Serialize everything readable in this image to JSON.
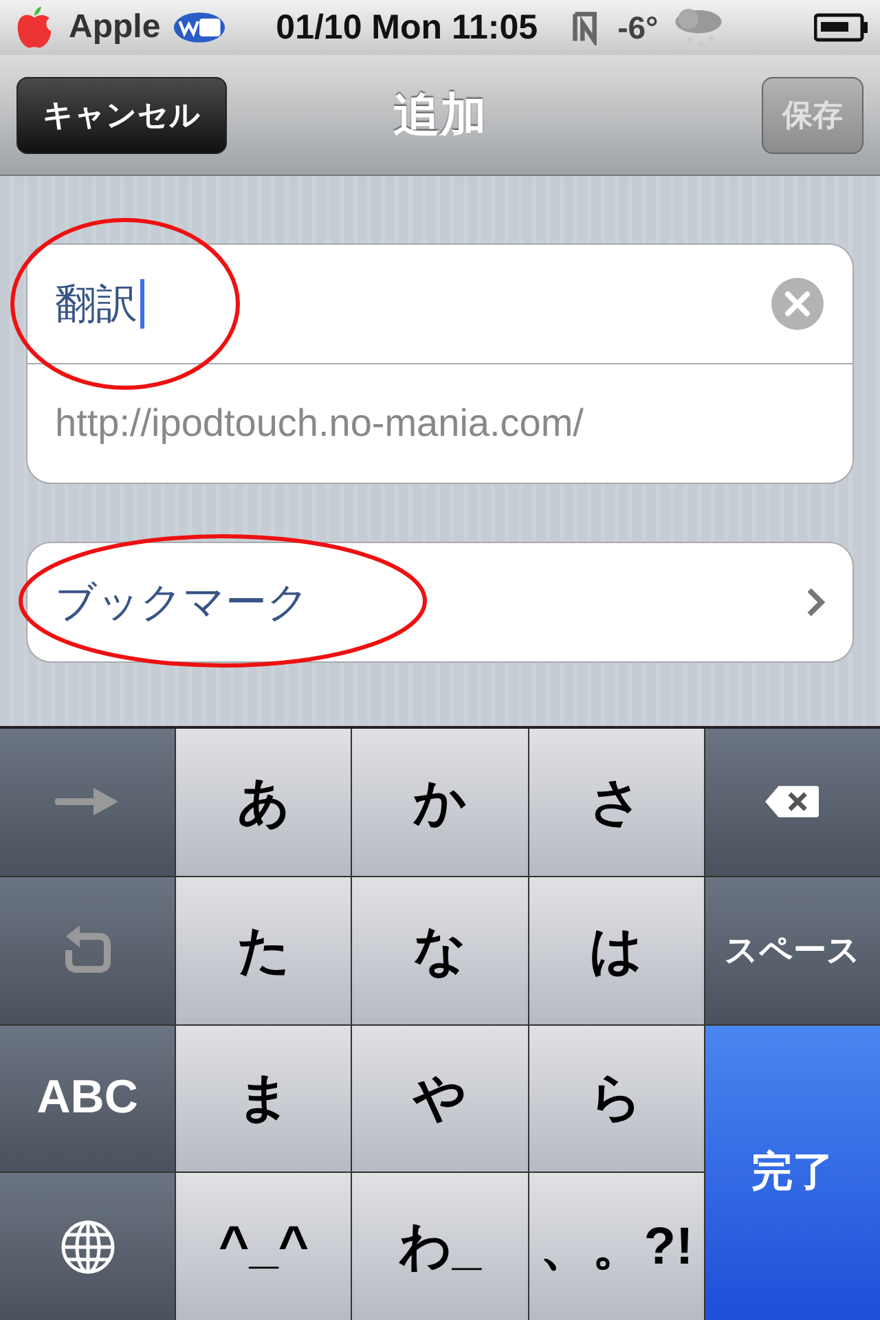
{
  "status_bar": {
    "carrier": "Apple",
    "datetime": "01/10 Mon 11:05",
    "temperature": "-6°"
  },
  "nav_bar": {
    "cancel": "キャンセル",
    "title": "追加",
    "save": "保存",
    "save_disabled": true
  },
  "form": {
    "title_value": "翻訳",
    "title_highlighted": true,
    "url": "http://ipodtouch.no-mania.com/",
    "folder": "ブックマーク",
    "folder_highlighted": true
  },
  "keyboard": {
    "keys": [
      {
        "kind": "arrow"
      },
      {
        "kind": "char",
        "label": "あ"
      },
      {
        "kind": "char",
        "label": "か"
      },
      {
        "kind": "char",
        "label": "さ"
      },
      {
        "kind": "backspace"
      },
      {
        "kind": "undo"
      },
      {
        "kind": "char",
        "label": "た"
      },
      {
        "kind": "char",
        "label": "な"
      },
      {
        "kind": "char",
        "label": "は"
      },
      {
        "kind": "function",
        "label": "スペース"
      },
      {
        "kind": "function",
        "label": "ABC"
      },
      {
        "kind": "char",
        "label": "ま"
      },
      {
        "kind": "char",
        "label": "や"
      },
      {
        "kind": "char",
        "label": "ら"
      },
      {
        "kind": "done",
        "label": "完了"
      },
      {
        "kind": "globe"
      },
      {
        "kind": "char",
        "label": "^_^"
      },
      {
        "kind": "char",
        "label": "わ_"
      },
      {
        "kind": "char",
        "label": "、。?!"
      }
    ]
  }
}
